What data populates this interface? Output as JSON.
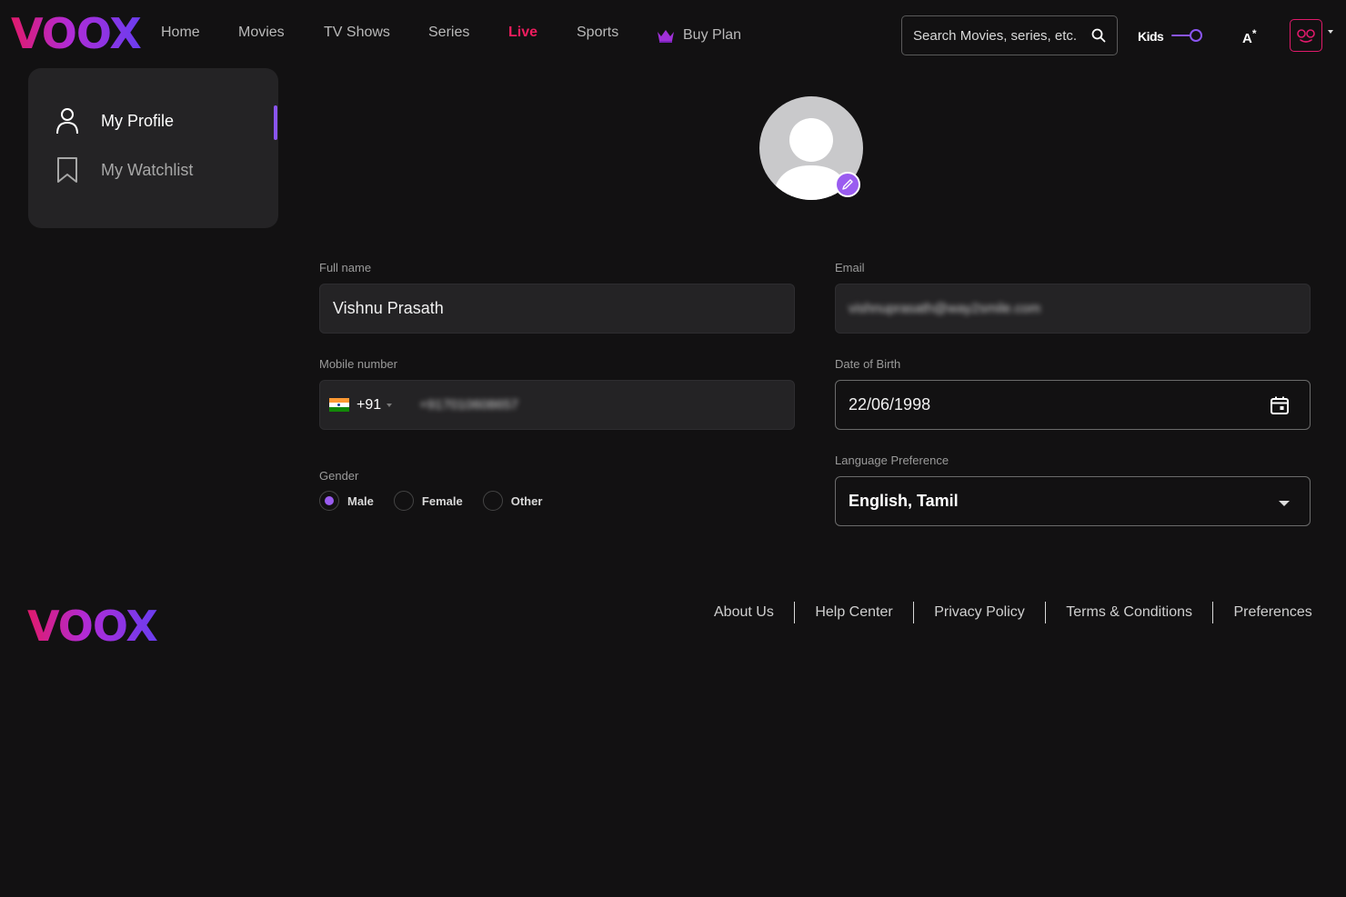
{
  "brand": {
    "name": "VOOX",
    "gradient": [
      "#e01a6b",
      "#b12bd6",
      "#6a3df0"
    ]
  },
  "header": {
    "nav": [
      {
        "label": "Home"
      },
      {
        "label": "Movies"
      },
      {
        "label": "TV Shows"
      },
      {
        "label": "Series"
      },
      {
        "label": "Live",
        "active": true,
        "color": "#ee1c5e"
      },
      {
        "label": "Sports"
      }
    ],
    "buy_plan": {
      "label": "Buy Plan",
      "icon": "crown-icon"
    },
    "search": {
      "placeholder": "Search Movies, series, etc.",
      "icon": "search-icon"
    },
    "kids": {
      "label": "Kids",
      "toggle_on": true
    },
    "language_icon": "translate-icon",
    "avatar_icon": "profile-mask-icon"
  },
  "sidebar": {
    "items": [
      {
        "label": "My Profile",
        "icon": "user-icon",
        "active": true
      },
      {
        "label": "My Watchlist",
        "icon": "bookmark-icon",
        "active": false
      }
    ],
    "accent": "#8a55f0"
  },
  "profile": {
    "photo_icon": "avatar-placeholder-icon",
    "edit_icon": "pencil-icon",
    "full_name": {
      "label": "Full name",
      "value": "Vishnu Prasath"
    },
    "email": {
      "label": "Email",
      "value": "vishnuprasath@way2smile.com"
    },
    "mobile": {
      "label": "Mobile number",
      "country_code": "+91",
      "flag": "india-flag-icon",
      "value": "+917010608657"
    },
    "dob": {
      "label": "Date of Birth",
      "value": "22/06/1998",
      "icon": "calendar-icon"
    },
    "gender": {
      "label": "Gender",
      "options": [
        "Male",
        "Female",
        "Other"
      ],
      "selected": "Male"
    },
    "language": {
      "label": "Language Preference",
      "value": "English, Tamil"
    }
  },
  "footer": {
    "links": [
      "About Us",
      "Help Center",
      "Privacy Policy",
      "Terms & Conditions",
      "Preferences"
    ]
  }
}
